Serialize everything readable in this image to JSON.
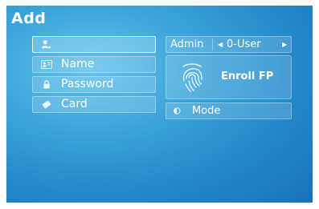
{
  "screen": {
    "title": "Add"
  },
  "form": {
    "user_id_value": "",
    "name_label": "Name",
    "password_label": "Password",
    "card_label": "Card"
  },
  "role": {
    "label": "Admin",
    "value": "0-User",
    "prev_icon": "triangle-left",
    "next_icon": "triangle-right"
  },
  "enroll": {
    "label": "Enroll FP",
    "icon": "fingerprint-icon"
  },
  "mode": {
    "label": "Mode",
    "icon": "half-circle-icon"
  },
  "colors": {
    "background": "#2a8ed0",
    "text": "#ffffff"
  }
}
